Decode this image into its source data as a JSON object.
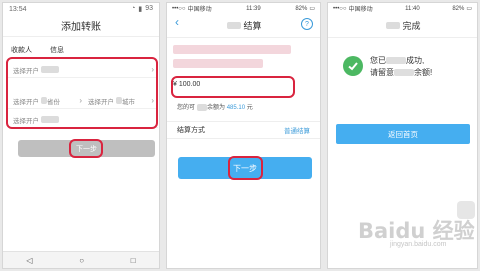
{
  "phone1": {
    "status_time": "13:54",
    "status_battery": "93",
    "title": "添加转账",
    "col_recipient": "收款人",
    "col_info": "信息",
    "field_bank1": "选择开户",
    "field_province": "选择开户",
    "field_province_suffix": "省份",
    "field_city": "选择开户",
    "field_city_suffix": "城市",
    "field_bank2": "选择开户",
    "next_button": "下一步"
  },
  "phone2": {
    "carrier": "中国移动",
    "time": "11:39",
    "battery": "82%",
    "title": "结算",
    "amount": "¥ 100.00",
    "balance_prefix": "您的可",
    "balance_middle": "余额为",
    "balance_value": "485.10",
    "balance_unit": "元",
    "pay_method_label": "结算方式",
    "pay_method_value": "普通结算",
    "next_button": "下一步"
  },
  "phone3": {
    "carrier": "中国移动",
    "time": "11:40",
    "battery": "82%",
    "title": "完成",
    "success_line1_a": "您已",
    "success_line1_b": "成功,",
    "success_line2_a": "请留意",
    "success_line2_b": "余额!",
    "home_button": "返回首页"
  },
  "watermark": {
    "text": "Baidu 经验",
    "sub": "jingyan.baidu.com"
  },
  "colors": {
    "highlight_box": "#d9243f",
    "accent_blue": "#45aef0",
    "success_green": "#4cb862"
  }
}
